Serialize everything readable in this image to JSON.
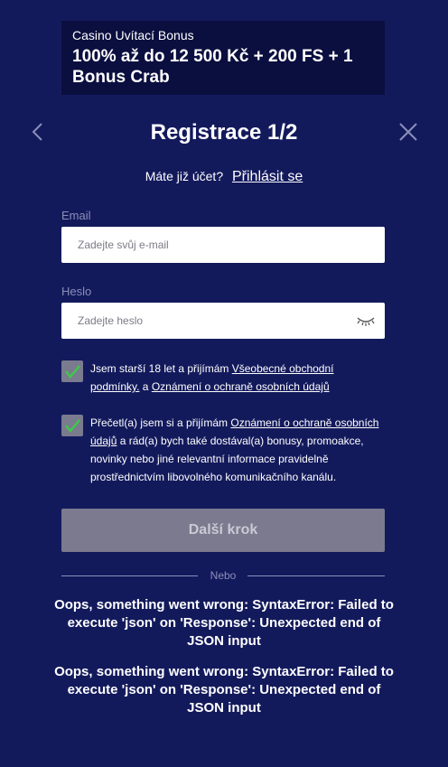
{
  "banner": {
    "subtitle": "Casino Uvítací Bonus",
    "title": "100% až do 12 500 Kč + 200 FS + 1 Bonus Crab"
  },
  "header": {
    "title": "Registrace 1/2",
    "back_icon": "chevron-left-icon",
    "close_icon": "close-icon"
  },
  "login": {
    "prompt": "Máte již účet?",
    "link": "Přihlásit se"
  },
  "form": {
    "email": {
      "label": "Email",
      "placeholder": "Zadejte svůj e-mail",
      "value": ""
    },
    "password": {
      "label": "Heslo",
      "placeholder": "Zadejte heslo",
      "value": "",
      "toggle_icon": "eye-closed-icon"
    }
  },
  "consents": [
    {
      "checked": true,
      "text_1": "Jsem starší 18 let a přijímám ",
      "link_1": "Všeobecné obchodní podmínky.",
      "text_2": " a ",
      "link_2": "Oznámení o ochraně osobních údajů"
    },
    {
      "checked": true,
      "text_1": "Přečetl(a) jsem si a přijímám ",
      "link_1": "Oznámení o ochraně osobních údajů",
      "text_2": " a rád(a) bych také dostával(a) bonusy, promoakce, novinky nebo jiné relevantní informace pravidelně prostřednictvím libovolného komunikačního kanálu."
    }
  ],
  "next_button": {
    "label": "Další krok"
  },
  "divider": {
    "text": "Nebo"
  },
  "errors": [
    "Oops, something went wrong: SyntaxError: Failed to execute 'json' on 'Response': Unexpected end of JSON input",
    "Oops, something went wrong: SyntaxError: Failed to execute 'json' on 'Response': Unexpected end of JSON input"
  ],
  "colors": {
    "background": "#131a5c",
    "banner_background": "#0b0f3f",
    "checkbox": "#7a7b8f",
    "checkmark": "#3ec94a",
    "button_disabled": "#7b7a8e",
    "muted_text": "#8a8fb8"
  }
}
